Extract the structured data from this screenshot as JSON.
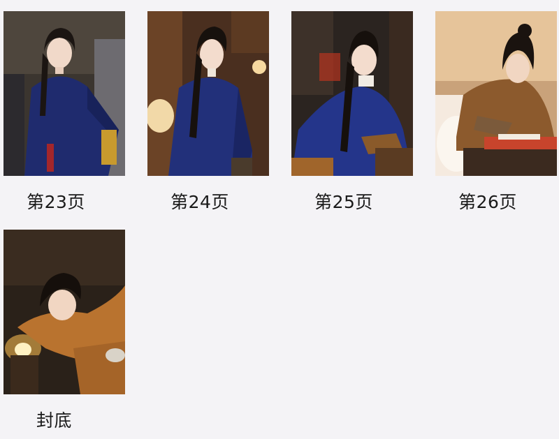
{
  "pages": [
    {
      "caption": "第23页"
    },
    {
      "caption": "第24页"
    },
    {
      "caption": "第25页"
    },
    {
      "caption": "第26页"
    },
    {
      "caption": "封底"
    }
  ],
  "colors": {
    "background": "#f4f3f6",
    "caption_text": "#1a1a1a",
    "cloak_blue": "#1f2f7a",
    "robe_orange": "#b8722e"
  }
}
